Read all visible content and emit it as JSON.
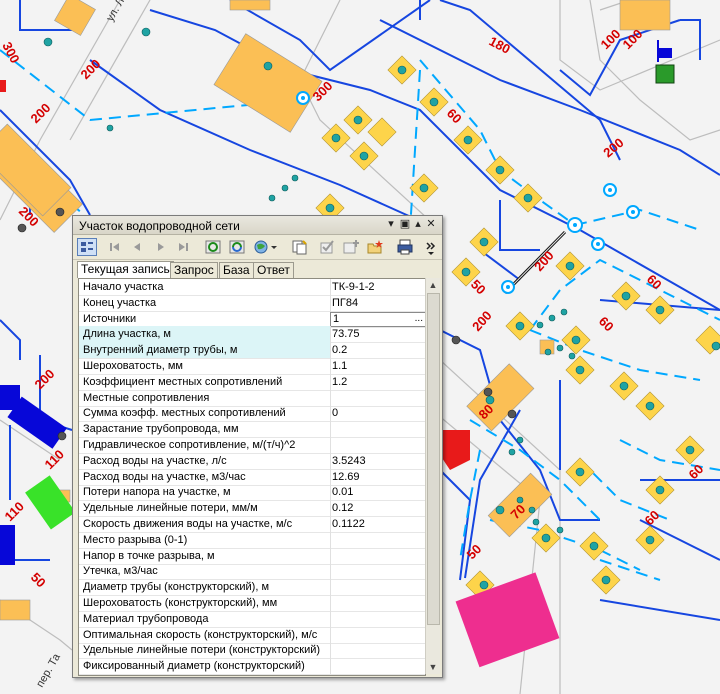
{
  "map": {
    "street_labels": [
      "ул. Л",
      "пер. Та"
    ],
    "pipe_labels": [
      "300",
      "200",
      "200",
      "100",
      "180",
      "100",
      "300",
      "60",
      "200",
      "60",
      "200",
      "200",
      "50",
      "200",
      "60",
      "80",
      "60",
      "70",
      "60",
      "50",
      "110",
      "110",
      "200",
      "50"
    ],
    "colors": {
      "building_orange": "#fbbf55",
      "building_yellow": "#fdd44a",
      "pipe_blue": "#1646e0",
      "dashed_cyan": "#00a8ff",
      "label_red": "#d40000",
      "magenta": "#ee2e8f",
      "green": "#39e229",
      "red_building": "#e81a1a",
      "dark_blue": "#0707d8"
    }
  },
  "window": {
    "title": "Участок водопроводной сети",
    "title_buttons": [
      "pin-icon",
      "restore-icon",
      "maximize-icon",
      "close-icon"
    ],
    "toolbar_icons": [
      "grid-view-icon",
      "first-record-icon",
      "prev-record-icon",
      "next-record-icon",
      "last-record-icon",
      "refresh-icon",
      "sync-icon",
      "globe-icon",
      "dropdown-arrow-icon",
      "copy-icon",
      "checkmark-icon",
      "add-record-icon",
      "new-folder-icon",
      "print-icon",
      "overflow-icon"
    ],
    "tabs": [
      "Текущая запись",
      "Запрос",
      "База",
      "Ответ"
    ],
    "active_tab": "Текущая запись",
    "ellipsis": "...",
    "rows": [
      {
        "label": "Начало участка",
        "value": "ТК-9-1-2"
      },
      {
        "label": "Конец участка",
        "value": "ПГ84"
      },
      {
        "label": "Источники",
        "value": "1"
      },
      {
        "label": "Длина участка, м",
        "value": "73.75"
      },
      {
        "label": "Внутренний диаметр трубы, м",
        "value": "0.2"
      },
      {
        "label": "Шероховатость, мм",
        "value": "1.1"
      },
      {
        "label": "Коэффициент местных сопротивлений",
        "value": "1.2"
      },
      {
        "label": "Местные сопротивления",
        "value": ""
      },
      {
        "label": "Сумма коэфф. местных сопротивлений",
        "value": "0"
      },
      {
        "label": "Зарастание трубопровода, мм",
        "value": ""
      },
      {
        "label": "Гидравлическое сопротивление,  м/(т/ч)^2",
        "value": ""
      },
      {
        "label": "Расход воды на участке, л/с",
        "value": "3.5243"
      },
      {
        "label": "Расход воды на участке, м3/час",
        "value": "12.69"
      },
      {
        "label": "Потери напора на участке, м",
        "value": "0.01"
      },
      {
        "label": "Удельные линейные потери, мм/м",
        "value": "0.12"
      },
      {
        "label": "Скорость движения воды на участке, м/с",
        "value": "0.1122"
      },
      {
        "label": "Место разрыва (0-1)",
        "value": ""
      },
      {
        "label": "Напор в точке разрыва, м",
        "value": ""
      },
      {
        "label": "Утечка, м3/час",
        "value": ""
      },
      {
        "label": "Диаметр трубы (конструкторский), м",
        "value": ""
      },
      {
        "label": "Шероховатость (конструкторский), мм",
        "value": ""
      },
      {
        "label": "Материал трубопровода",
        "value": ""
      },
      {
        "label": "Оптимальная скорость (конструкторский), м/с",
        "value": ""
      },
      {
        "label": "Удельные линейные потери (конструкторский)",
        "value": ""
      },
      {
        "label": "Фиксированный диаметр (конструкторский)",
        "value": ""
      }
    ]
  }
}
